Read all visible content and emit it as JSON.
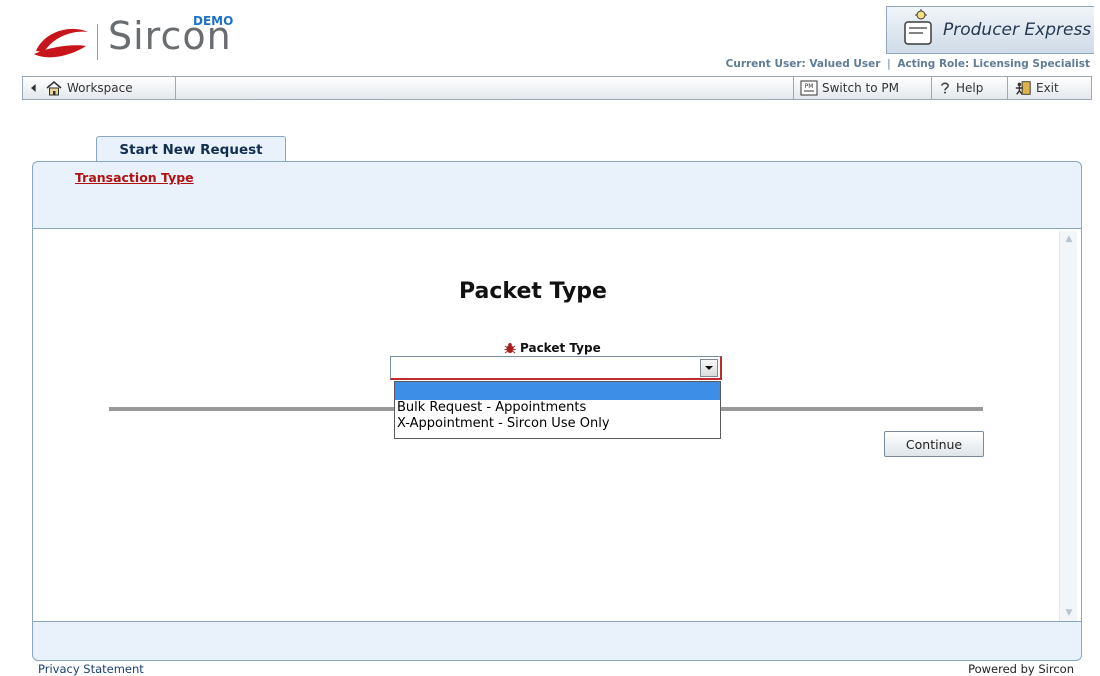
{
  "header": {
    "logo_text": "Sircon",
    "demo_label": "DEMO",
    "product_name": "Producer Express",
    "current_user_label": "Current User: Valued User",
    "separator": "|",
    "acting_role_label": "Acting Role: Licensing Specialist"
  },
  "toolbar": {
    "workspace_label": "Workspace",
    "switch_label": "Switch to PM",
    "help_label": "Help",
    "exit_label": "Exit"
  },
  "tab": {
    "label": "Start New Request"
  },
  "panel": {
    "transaction_type_link": "Transaction Type",
    "page_heading": "Packet Type",
    "field_label": "Packet Type",
    "select_value": "",
    "dropdown_options": [
      "",
      "Bulk Request - Appointments",
      "X-Appointment - Sircon Use Only"
    ],
    "continue_label": "Continue"
  },
  "footer": {
    "privacy_label": "Privacy Statement",
    "powered_by": "Powered by Sircon"
  },
  "colors": {
    "accent_blue": "#3d8ee6",
    "link_red": "#b01212",
    "panel_bg": "#e9f1fa",
    "required_red": "#c02b2b"
  }
}
